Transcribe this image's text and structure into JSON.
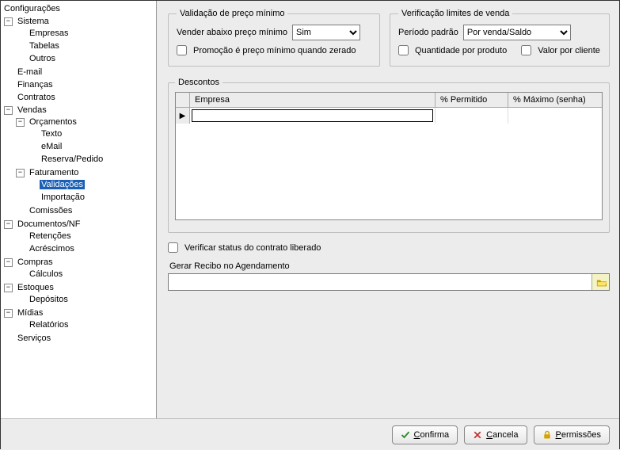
{
  "sidebar": {
    "title": "Configurações",
    "items": {
      "sistema": "Sistema",
      "empresas": "Empresas",
      "tabelas": "Tabelas",
      "outros": "Outros",
      "email": "E-mail",
      "financas": "Finanças",
      "contratos": "Contratos",
      "vendas": "Vendas",
      "orcamentos": "Orçamentos",
      "texto": "Texto",
      "email2": "eMail",
      "reserva": "Reserva/Pedido",
      "faturamento": "Faturamento",
      "validacoes": "Validações",
      "importacao": "Importação",
      "comissoes": "Comissões",
      "documentos": "Documentos/NF",
      "retencoes": "Retenções",
      "acrescimos": "Acréscimos",
      "compras": "Compras",
      "calculos": "Cálculos",
      "estoques": "Estoques",
      "depositos": "Depósitos",
      "midias": "Mídias",
      "relatorios": "Relatórios",
      "servicos": "Serviços"
    }
  },
  "fs_min": {
    "legend": "Validação de preço mínimo",
    "vender_label": "Vender abaixo preço mínimo",
    "vender_value": "Sim",
    "promo_label": "Promoção é preço mínimo quando zerado"
  },
  "fs_lim": {
    "legend": "Verificação limites de venda",
    "periodo_label": "Período padrão",
    "periodo_value": "Por venda/Saldo",
    "qtd_label": "Quantidade por produto",
    "valor_label": "Valor por cliente"
  },
  "fs_desc": {
    "legend": "Descontos",
    "col_empresa": "Empresa",
    "col_permitido": "% Permitido",
    "col_maximo": "% Máximo (senha)",
    "row_marker": "▶"
  },
  "lower": {
    "verificar_label": "Verificar status do contrato liberado",
    "recibo_label": "Gerar Recibo no Agendamento",
    "recibo_value": ""
  },
  "footer": {
    "confirma": "Confirma",
    "cancela": "Cancela",
    "permissoes": "Permissões",
    "confirma_accel": "C",
    "cancela_accel": "C",
    "permissoes_accel": "P"
  }
}
